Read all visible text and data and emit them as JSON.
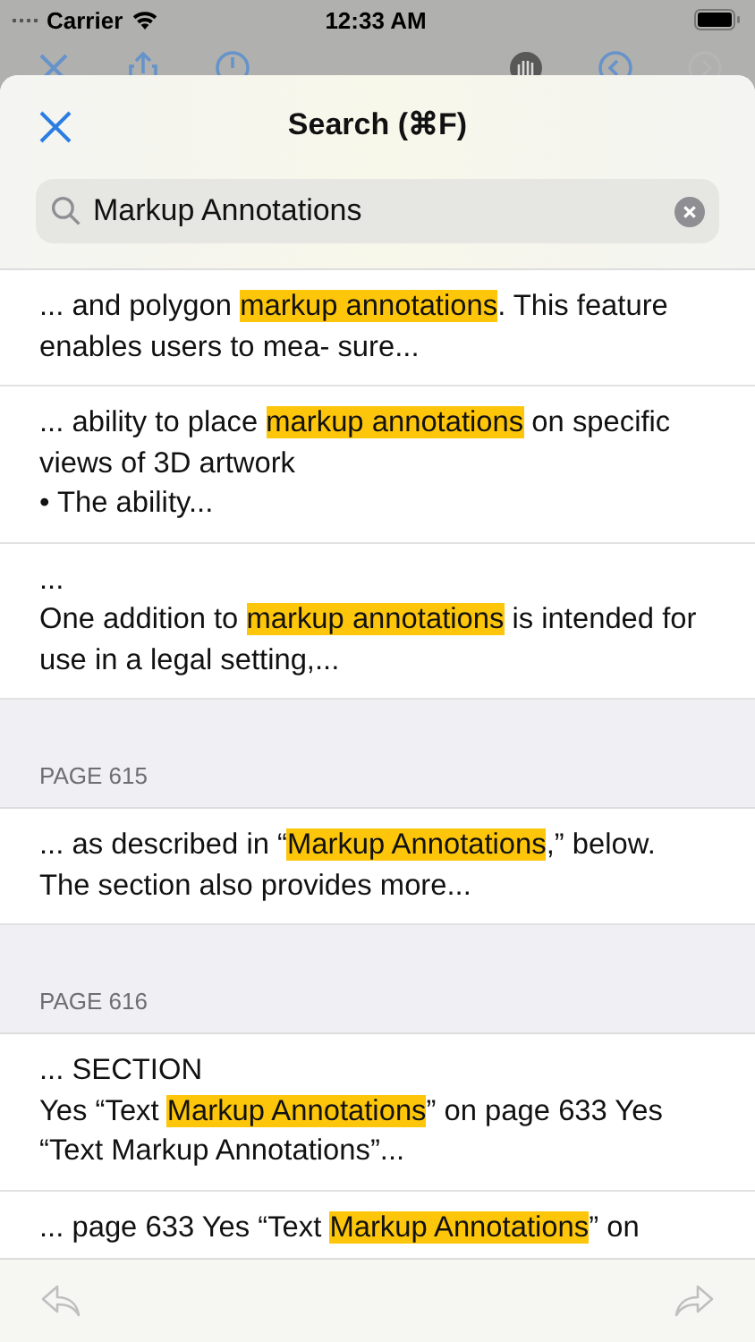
{
  "status_bar": {
    "carrier": "Carrier",
    "time": "12:33 AM"
  },
  "sheet": {
    "title": "Search (⌘F)"
  },
  "search": {
    "value": "Markup Annotations"
  },
  "results": [
    {
      "kind": "result",
      "segments": [
        {
          "text": "... and polygon ",
          "highlight": false
        },
        {
          "text": "markup annotations",
          "highlight": true
        },
        {
          "text": ". This feature enables users to mea- sure...",
          "highlight": false
        }
      ]
    },
    {
      "kind": "result",
      "segments": [
        {
          "text": "... ability to place ",
          "highlight": false
        },
        {
          "text": "markup annotations",
          "highlight": true
        },
        {
          "text": " on specific views of 3D artwork\n• The ability...",
          "highlight": false
        }
      ]
    },
    {
      "kind": "result",
      "segments": [
        {
          "text": "...\nOne addition to ",
          "highlight": false
        },
        {
          "text": "markup annotations",
          "highlight": true
        },
        {
          "text": " is intended for use in a legal setting,...",
          "highlight": false
        }
      ]
    },
    {
      "kind": "header",
      "label": "PAGE 615"
    },
    {
      "kind": "result",
      "segments": [
        {
          "text": "... as described in “",
          "highlight": false
        },
        {
          "text": "Markup Annotations",
          "highlight": true
        },
        {
          "text": ",” below. The section also provides more...",
          "highlight": false
        }
      ]
    },
    {
      "kind": "header",
      "label": "PAGE 616"
    },
    {
      "kind": "result",
      "segments": [
        {
          "text": "... SECTION\nYes “Text ",
          "highlight": false
        },
        {
          "text": "Markup Annotations",
          "highlight": true
        },
        {
          "text": "” on page 633 Yes “Text Markup Annotations”...",
          "highlight": false
        }
      ]
    },
    {
      "kind": "result",
      "segments": [
        {
          "text": "... page 633 Yes “Text ",
          "highlight": false
        },
        {
          "text": "Markup Annotations",
          "highlight": true
        },
        {
          "text": "” on",
          "highlight": false
        }
      ]
    }
  ]
}
